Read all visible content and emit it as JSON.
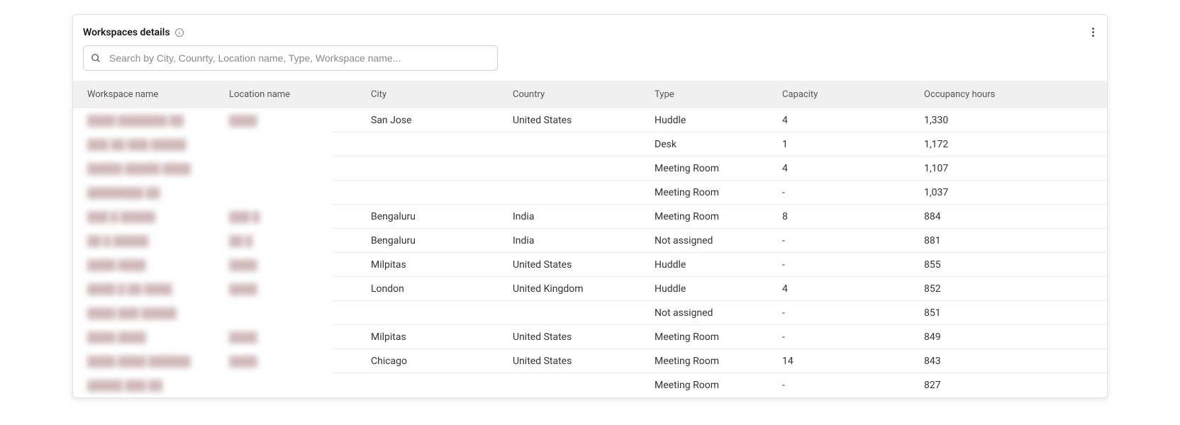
{
  "header": {
    "title": "Workspaces details"
  },
  "search": {
    "placeholder": "Search by City, Counrty, Location name, Type, Workspace name..."
  },
  "table": {
    "columns": {
      "workspace_name": "Workspace name",
      "location_name": "Location name",
      "city": "City",
      "country": "Country",
      "type": "Type",
      "capacity": "Capacity",
      "occupancy_hours": "Occupancy hours"
    },
    "rows": [
      {
        "workspace_name": "████ ███████ ██",
        "location_name": "████",
        "city": "San Jose",
        "country": "United States",
        "type": "Huddle",
        "capacity": "4",
        "occupancy_hours": "1,330"
      },
      {
        "workspace_name": "███ ██ ███ █████",
        "location_name": "",
        "city": "",
        "country": "",
        "type": "Desk",
        "capacity": "1",
        "occupancy_hours": "1,172"
      },
      {
        "workspace_name": "█████ █████ ████",
        "location_name": "",
        "city": "",
        "country": "",
        "type": "Meeting Room",
        "capacity": "4",
        "occupancy_hours": "1,107"
      },
      {
        "workspace_name": "████████ ██",
        "location_name": "",
        "city": "",
        "country": "",
        "type": "Meeting Room",
        "capacity": "-",
        "occupancy_hours": "1,037"
      },
      {
        "workspace_name": "███ █ █████",
        "location_name": "███ █",
        "city": "Bengaluru",
        "country": "India",
        "type": "Meeting Room",
        "capacity": "8",
        "occupancy_hours": "884"
      },
      {
        "workspace_name": "██ █ █████",
        "location_name": "██ █",
        "city": "Bengaluru",
        "country": "India",
        "type": "Not assigned",
        "capacity": "-",
        "occupancy_hours": "881"
      },
      {
        "workspace_name": "████ ████",
        "location_name": "████",
        "city": "Milpitas",
        "country": "United States",
        "type": "Huddle",
        "capacity": "-",
        "occupancy_hours": "855"
      },
      {
        "workspace_name": "████ █ ██ ████",
        "location_name": "████",
        "city": "London",
        "country": "United Kingdom",
        "type": "Huddle",
        "capacity": "4",
        "occupancy_hours": "852"
      },
      {
        "workspace_name": "████ ███ █████",
        "location_name": "",
        "city": "",
        "country": "",
        "type": "Not assigned",
        "capacity": "-",
        "occupancy_hours": "851"
      },
      {
        "workspace_name": "████ ████",
        "location_name": "████",
        "city": "Milpitas",
        "country": "United States",
        "type": "Meeting Room",
        "capacity": "-",
        "occupancy_hours": "849"
      },
      {
        "workspace_name": "████ ████ ██████",
        "location_name": "████",
        "city": "Chicago",
        "country": "United States",
        "type": "Meeting Room",
        "capacity": "14",
        "occupancy_hours": "843"
      },
      {
        "workspace_name": "█████ ███ ██",
        "location_name": "",
        "city": "",
        "country": "",
        "type": "Meeting Room",
        "capacity": "-",
        "occupancy_hours": "827"
      }
    ]
  }
}
